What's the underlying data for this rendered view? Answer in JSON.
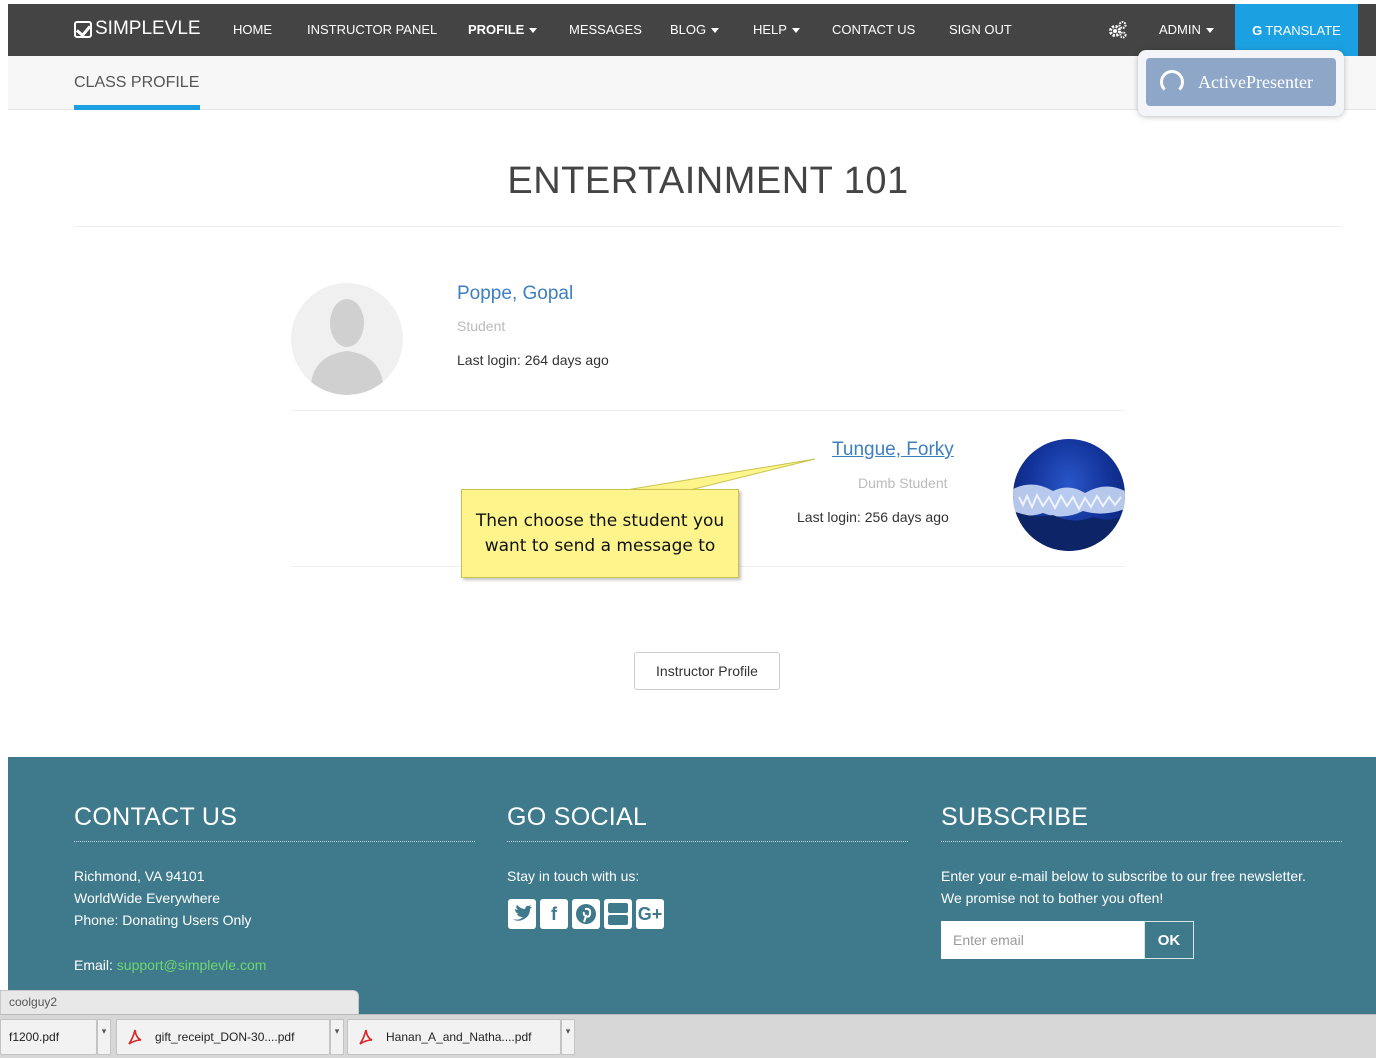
{
  "nav": {
    "brand": "SIMPLEVLE",
    "items": [
      {
        "label": "HOME"
      },
      {
        "label": "INSTRUCTOR PANEL"
      },
      {
        "label": "PROFILE"
      },
      {
        "label": "MESSAGES"
      },
      {
        "label": "BLOG"
      },
      {
        "label": "HELP"
      },
      {
        "label": "CONTACT US"
      },
      {
        "label": "SIGN OUT"
      }
    ],
    "admin": "ADMIN",
    "translate_g": "G",
    "translate": "TRANSLATE"
  },
  "subnav": {
    "tab": "CLASS PROFILE"
  },
  "watermark": "ActivePresenter",
  "page": {
    "title": "ENTERTAINMENT 101"
  },
  "students": [
    {
      "name": "Poppe, Gopal",
      "role": "Student",
      "last_login": "Last login: 264 days ago"
    },
    {
      "name": "Tungue, Forky",
      "role": "Dumb Student",
      "last_login": "Last login: 256 days ago"
    }
  ],
  "callout": "Then choose the student you want to send a message to",
  "instructor_button": "Instructor Profile",
  "footer": {
    "contact": {
      "heading": "CONTACT US",
      "line1": "Richmond, VA 94101",
      "line2": "WorldWide Everywhere",
      "line3": "Phone: Donating Users Only",
      "email_label": "Email: ",
      "email": "support@simplevle.com"
    },
    "social": {
      "heading": "GO SOCIAL",
      "text": "Stay in touch with us:",
      "icons": [
        "twitter-icon",
        "facebook-icon",
        "pinterest-icon",
        "youtube-icon",
        "google-plus-icon"
      ]
    },
    "subscribe": {
      "heading": "SUBSCRIBE",
      "line1": "Enter your e-mail below to subscribe to our free newsletter.",
      "line2": "We promise not to bother you often!",
      "placeholder": "Enter email",
      "button": "OK"
    }
  },
  "browser": {
    "user_tab": "coolguy2",
    "downloads": [
      "f1200.pdf",
      "gift_receipt_DON-30....pdf",
      "Hanan_A_and_Natha....pdf"
    ]
  },
  "colors": {
    "nav_bg": "#444444",
    "accent": "#1ba1e2",
    "link": "#3d7fc1",
    "footer_bg": "#3e7a8b",
    "callout_bg": "#fdf58b"
  }
}
